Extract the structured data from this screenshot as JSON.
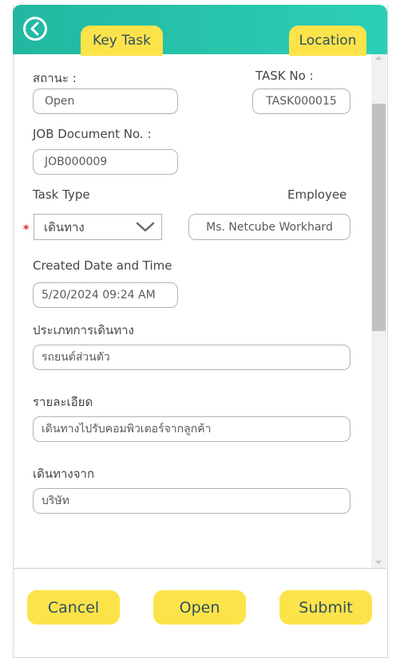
{
  "header": {
    "tabs": [
      {
        "label": "Key Task"
      },
      {
        "label": "Location"
      }
    ]
  },
  "form": {
    "status": {
      "label": "สถานะ :",
      "value": "Open"
    },
    "task_no": {
      "label": "TASK No :",
      "value": "TASK000015"
    },
    "job_doc": {
      "label": "JOB Document No. :",
      "value": "JOB000009"
    },
    "task_type": {
      "label": "Task Type",
      "value": "เดินทาง",
      "required_mark": "*"
    },
    "employee": {
      "label": "Employee",
      "value": "Ms. Netcube  Workhard"
    },
    "created": {
      "label": "Created Date and Time",
      "value": "5/20/2024  09:24 AM"
    },
    "travel_type": {
      "label": "ประเภทการเดินทาง",
      "value": "รถยนต์ส่วนตัว"
    },
    "details": {
      "label": "รายละเอียด",
      "value": "เดินทางไปรับคอมพิวเตอร์จากลูกค้า"
    },
    "travel_from": {
      "label": "เดินทางจาก",
      "value": "บริษัท"
    }
  },
  "footer": {
    "cancel": "Cancel",
    "open": "Open",
    "submit": "Submit"
  },
  "colors": {
    "header": "#2bc7ae",
    "accent_yellow": "#fde34a",
    "required": "#e02424"
  },
  "icons": {
    "back": "back-circle-icon",
    "dropdown": "chevron-down-icon"
  }
}
